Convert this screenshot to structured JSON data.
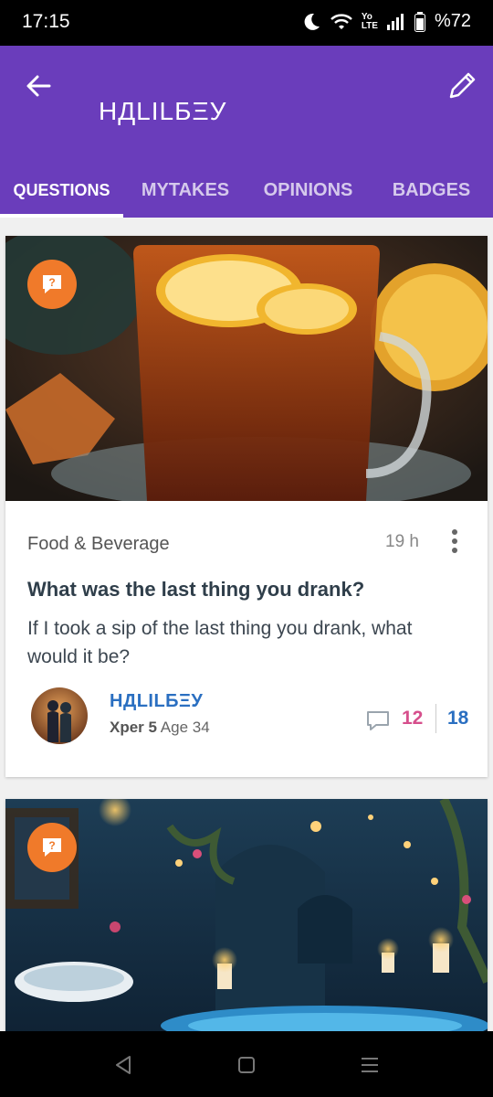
{
  "status_bar": {
    "time": "17:15",
    "lte_top": "Yo",
    "lte_bottom": "LTE",
    "battery": "%72",
    "icons": [
      "moon-icon",
      "wifi-icon",
      "signal-icon",
      "battery-icon"
    ]
  },
  "header": {
    "title": "НДLILБΞУ",
    "back_icon": "arrow-left-icon",
    "edit_icon": "pencil-icon",
    "background": "#6a3dbb"
  },
  "tabs": [
    {
      "label": "QUESTIONS",
      "active": true
    },
    {
      "label": "MYTAKES",
      "active": false
    },
    {
      "label": "OPINIONS",
      "active": false
    },
    {
      "label": "BADGES",
      "active": false
    }
  ],
  "posts": [
    {
      "category": "Food & Beverage",
      "time": "19 h",
      "title": "What was the last thing you drank?",
      "body": "If I took a sip of the last thing you drank, what would it be?",
      "author": {
        "name": "НДLILБΞУ",
        "level": "Xper 5",
        "age": "Age 34"
      },
      "opinions": "12",
      "likes": "18",
      "image": "tea-with-lemon"
    },
    {
      "image": "candle-lit-bathroom"
    }
  ],
  "colors": {
    "accent_orange": "#f07a2a",
    "opinions_pink": "#d64f8c",
    "link_blue": "#2a6fc1"
  }
}
